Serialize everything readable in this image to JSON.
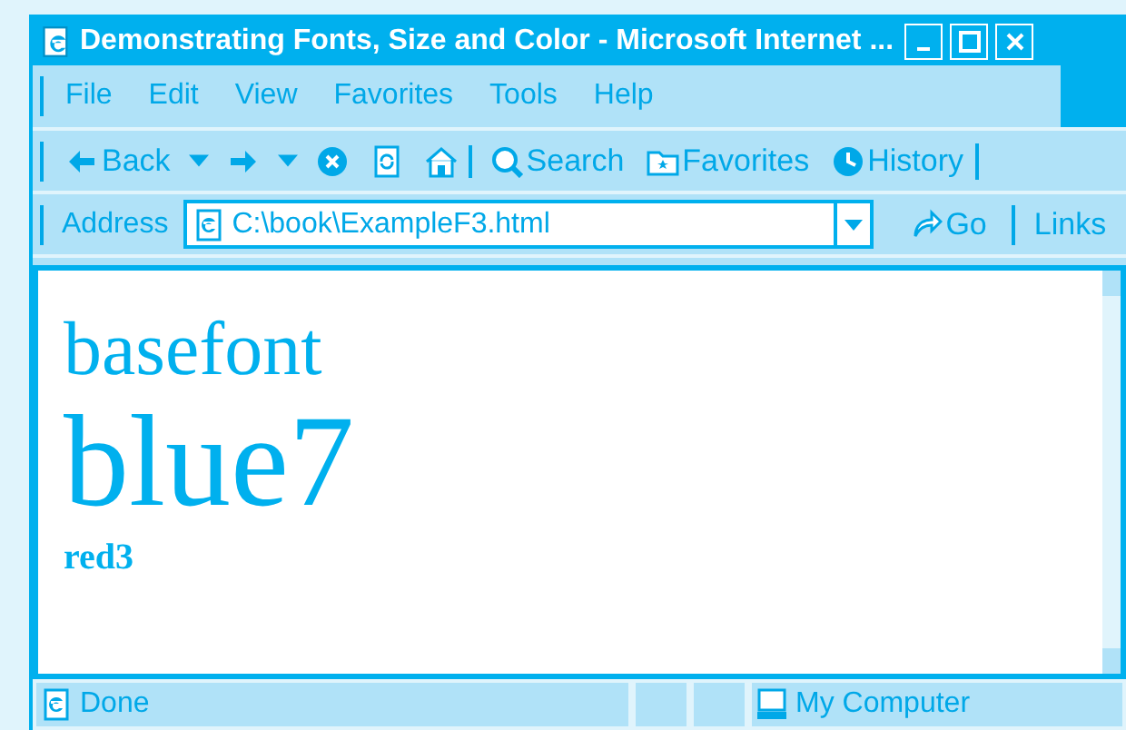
{
  "window": {
    "title": "Demonstrating Fonts, Size and Color - Microsoft Internet ..."
  },
  "menu_bar": {
    "items": [
      "File",
      "Edit",
      "View",
      "Favorites",
      "Tools",
      "Help"
    ]
  },
  "toolbar": {
    "buttons": [
      {
        "kind": "back",
        "label": "Back"
      },
      {
        "kind": "forward"
      },
      {
        "kind": "stop"
      },
      {
        "kind": "refresh"
      },
      {
        "kind": "home"
      },
      {
        "kind": "search",
        "label": "Search"
      },
      {
        "kind": "favorites",
        "label": "Favorites"
      },
      {
        "kind": "history",
        "label": "History"
      }
    ]
  },
  "address_bar": {
    "label": "Address",
    "value": "C:\\book\\ExampleF3.html",
    "go": "Go",
    "links": "Links"
  },
  "page": {
    "lines": [
      {
        "text": "basefont"
      },
      {
        "text": "blue7"
      },
      {
        "text": "red3"
      }
    ]
  },
  "status_bar": {
    "text": "Done",
    "zone": "My Computer"
  }
}
